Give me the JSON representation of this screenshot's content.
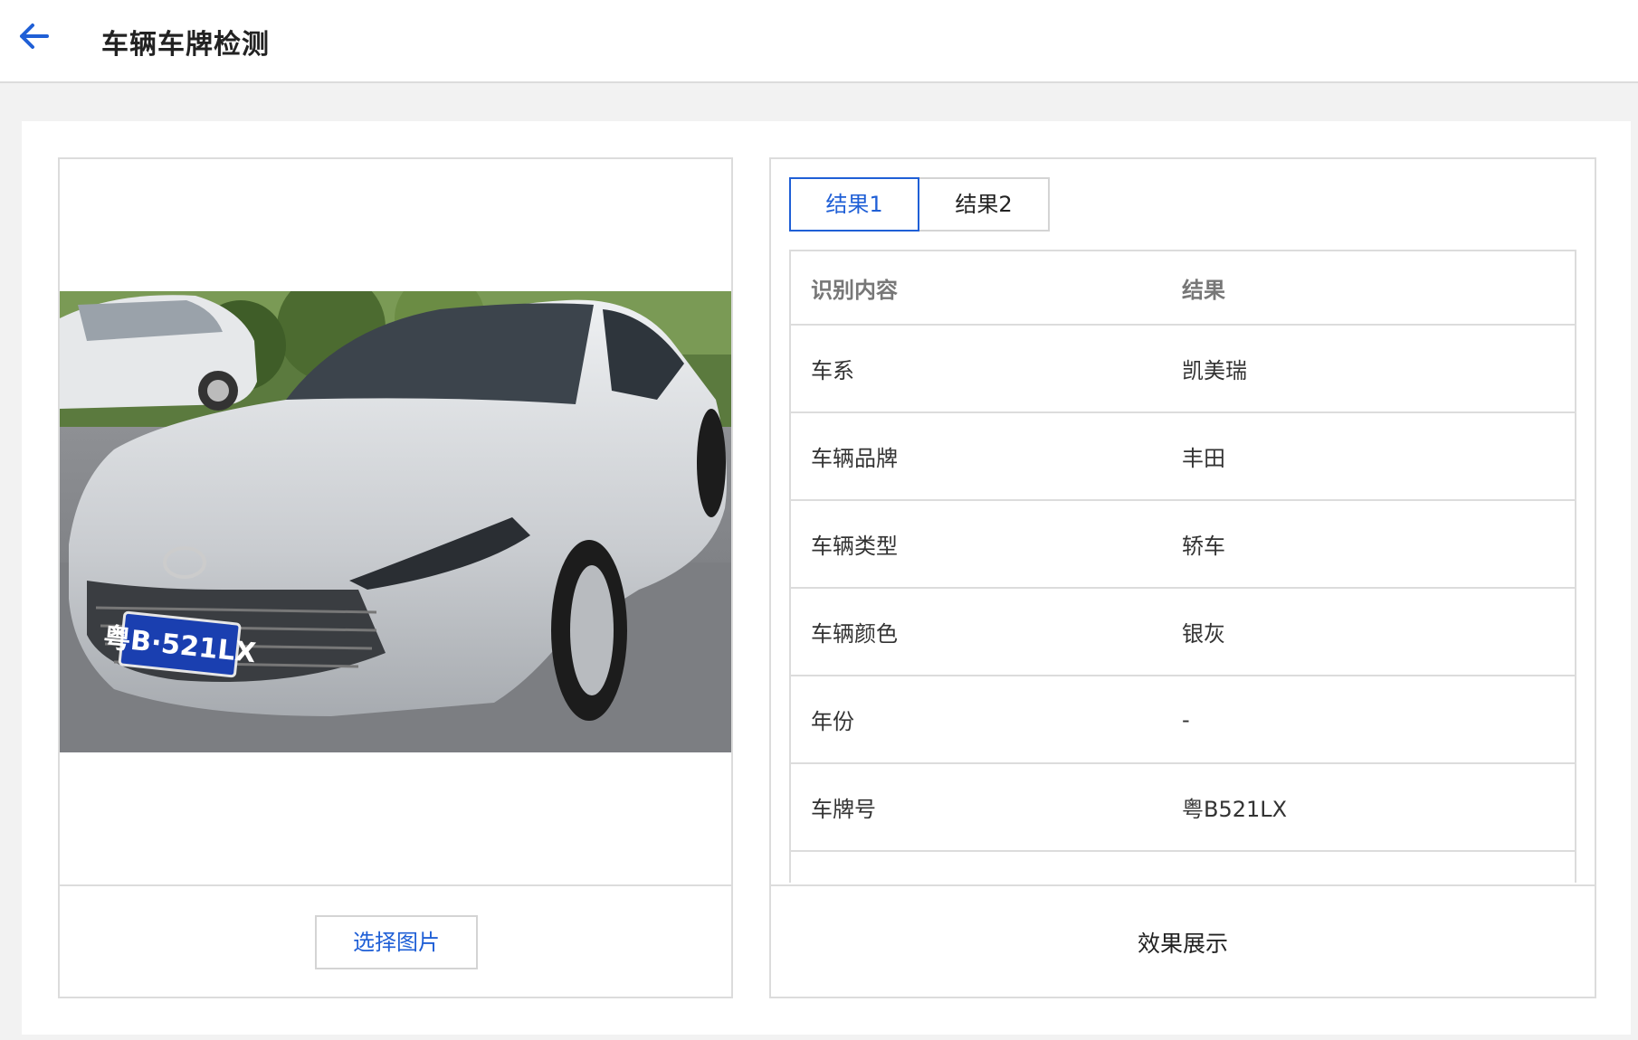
{
  "header": {
    "title": "车辆车牌检测"
  },
  "left": {
    "select_button": "选择图片",
    "plate_on_photo": "粤B·521LX"
  },
  "right": {
    "tabs": [
      {
        "label": "结果1",
        "active": true
      },
      {
        "label": "结果2",
        "active": false
      }
    ],
    "table": {
      "headers": [
        "识别内容",
        "结果"
      ],
      "rows": [
        [
          "车系",
          "凯美瑞"
        ],
        [
          "车辆品牌",
          "丰田"
        ],
        [
          "车辆类型",
          "轿车"
        ],
        [
          "车辆颜色",
          "银灰"
        ],
        [
          "年份",
          "-"
        ],
        [
          "车牌号",
          "粤B521LX"
        ]
      ]
    },
    "footer_label": "效果展示"
  },
  "colors": {
    "accent": "#1f5fd6",
    "border": "#dcdcdc",
    "page_bg": "#f2f2f2"
  }
}
